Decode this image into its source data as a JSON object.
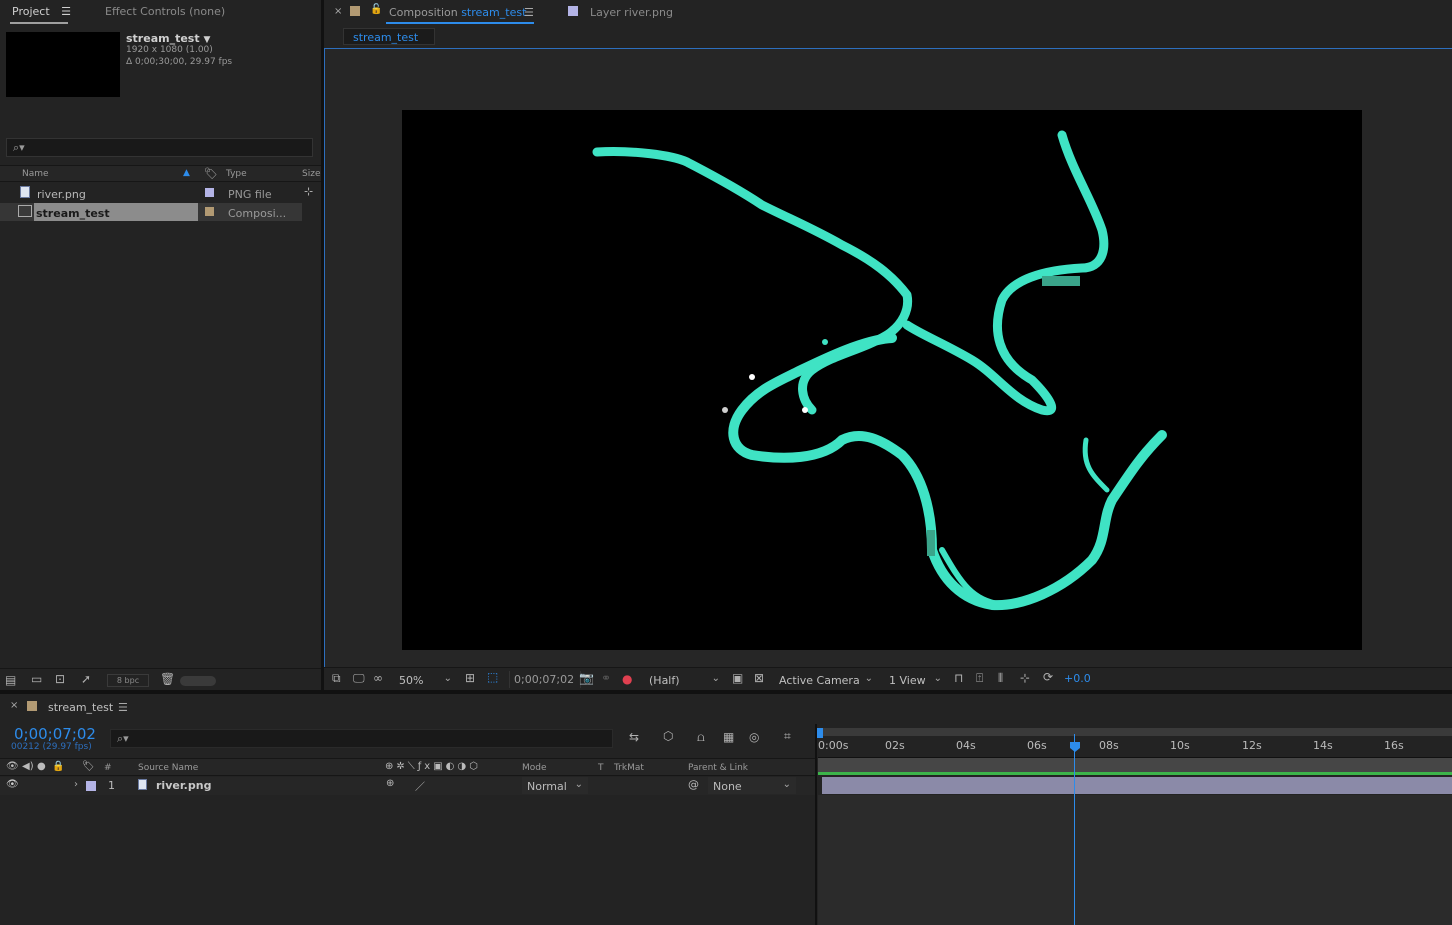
{
  "project_panel": {
    "tab_label": "Project",
    "effect_controls_tab": "Effect Controls (none)",
    "comp_name": "stream_test",
    "comp_resolution": "1920 x 1080 (1.00)",
    "comp_duration": "Δ 0;00;30;00, 29.97 fps",
    "columns": {
      "name": "Name",
      "type": "Type",
      "size": "Size"
    },
    "items": [
      {
        "name": "river.png",
        "type": "PNG file",
        "color": "#b4b4e6"
      },
      {
        "name": "stream_test",
        "type": "Composi...",
        "color": "#b29a73"
      }
    ],
    "bpc_label": "8 bpc"
  },
  "comp_panel": {
    "tab_prefix": "Composition",
    "tab_comp_name": "stream_test",
    "layer_tab": "Layer river.png",
    "breadcrumb": "stream_test",
    "toolbar": {
      "zoom": "50%",
      "timecode": "0;00;07;02",
      "resolution": "(Half)",
      "camera": "Active Camera",
      "views": "1 View",
      "exposure": "+0.0"
    }
  },
  "timeline": {
    "tab_label": "stream_test",
    "current_time": "0;00;07;02",
    "frame_info": "00212 (29.97 fps)",
    "headers": {
      "num": "#",
      "source_name": "Source Name",
      "mode": "Mode",
      "t": "T",
      "trkmat": "TrkMat",
      "parent": "Parent & Link"
    },
    "layers": [
      {
        "num": "1",
        "name": "river.png",
        "mode": "Normal",
        "parent": "None",
        "color": "#b4b4e6"
      }
    ],
    "ruler_ticks": [
      "0:00s",
      "02s",
      "04s",
      "06s",
      "08s",
      "10s",
      "12s",
      "14s",
      "16s"
    ]
  }
}
